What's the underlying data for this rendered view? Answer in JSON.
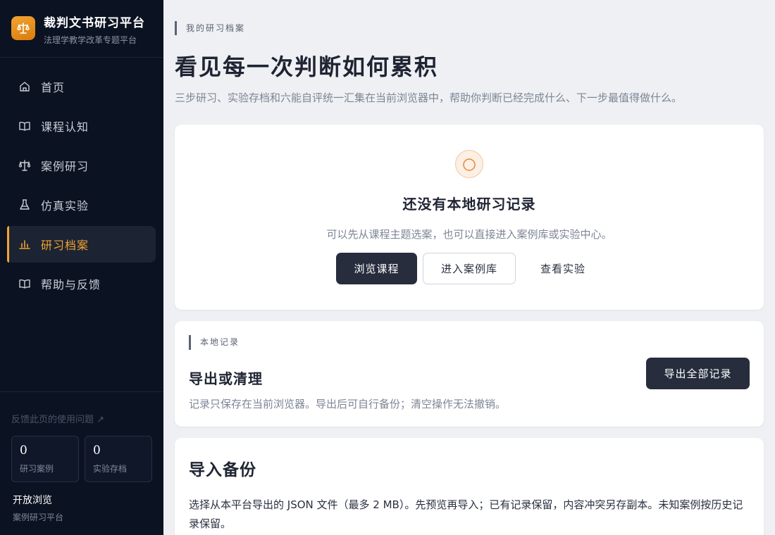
{
  "brand": {
    "title": "裁判文书研习平台",
    "subtitle": "法理学教学改革专题平台",
    "logo_icon": "scales-icon",
    "accent_color": "#f2a431"
  },
  "nav": {
    "items": [
      {
        "label": "首页",
        "icon": "home-icon",
        "active": false
      },
      {
        "label": "课程认知",
        "icon": "book-icon",
        "active": false
      },
      {
        "label": "案例研习",
        "icon": "scales-icon",
        "active": false
      },
      {
        "label": "仿真实验",
        "icon": "flask-icon",
        "active": false
      },
      {
        "label": "研习档案",
        "icon": "bar-chart-icon",
        "active": true
      },
      {
        "label": "帮助与反馈",
        "icon": "book-icon",
        "active": false
      }
    ]
  },
  "sidebar_footer": {
    "feedback_link": "反馈此页的使用问题 ↗",
    "stats": [
      {
        "value": "0",
        "label": "研习案例"
      },
      {
        "value": "0",
        "label": "实验存档"
      }
    ],
    "open_title": "开放浏览",
    "open_subtitle": "案例研习平台"
  },
  "header": {
    "eyebrow": "我的研习档案",
    "title": "看见每一次判断如何累积",
    "description": "三步研习、实验存档和六能自评统一汇集在当前浏览器中，帮助你判断已经完成什么、下一步最值得做什么。"
  },
  "empty_state": {
    "icon": "circle-icon",
    "title": "还没有本地研习记录",
    "description": "可以先从课程主题选案，也可以直接进入案例库或实验中心。",
    "buttons": {
      "browse_courses": "浏览课程",
      "enter_cases": "进入案例库",
      "view_experiments": "查看实验"
    }
  },
  "local_records": {
    "tag": "本地记录",
    "title": "导出或清理",
    "description": "记录只保存在当前浏览器。导出后可自行备份；清空操作无法撤销。",
    "export_button": "导出全部记录"
  },
  "import_backup": {
    "title": "导入备份",
    "description": "选择从本平台导出的 JSON 文件（最多 2 MB）。先预览再导入；已有记录保留，内容冲突另存副本。未知案例按历史记录保留。"
  }
}
